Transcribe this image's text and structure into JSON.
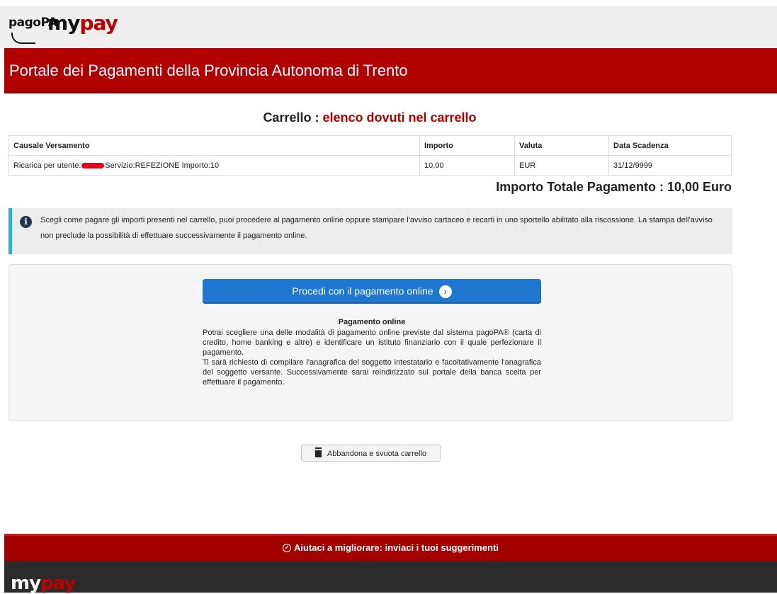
{
  "header": {
    "logo_pagopa": "pagoPA",
    "logo_my": "my",
    "logo_pay": "pay",
    "portal_title": "Portale dei Pagamenti della Provincia Autonoma di Trento"
  },
  "cart": {
    "title_prefix": "Carrello : ",
    "title_accent": "elenco dovuti nel carrello",
    "columns": [
      "Causale Versamento",
      "Importo",
      "Valuta",
      "Data Scadenza"
    ],
    "rows": [
      {
        "causale_prefix": "Ricarica per utente:",
        "causale_suffix": "Servizio:REFEZIONE Importo:10",
        "importo": "10,00",
        "valuta": "EUR",
        "scadenza": "31/12/9999"
      }
    ],
    "total_text": "Importo Totale Pagamento : 10,00 Euro"
  },
  "info": {
    "icon": "info-icon",
    "text": "Scegli come pagare gli importi presenti nel carrello, puoi procedere al pagamento online oppure stampare l'avviso cartaceo e recarti in uno sportello abilitato alla riscossione. La stampa dell'avviso non preclude la possibilità di effettuare successivamente il pagamento online."
  },
  "payment": {
    "button_label": "Procedi con il pagamento online",
    "heading": "Pagamento online",
    "description_1": "Potrai scegliere una delle modalità di pagamento online previste dal sistema pagoPA® (carta di credito, home banking e altre) e identificare un istituto finanziario con il quale perfezionare il pagamento.",
    "description_2": "Ti sarà richiesto di compilare l'anagrafica del soggetto intestatario e facoltativamente l'anagrafica del soggetto versante. Successivamente sarai reindirizzato sul portale della banca scelta per effettuare il pagamento."
  },
  "abandon_button": "Abbandona e svuota carrello",
  "footer": {
    "feedback_text": "Aiutaci a migliorare: inviaci i tuoi suggerimenti",
    "logo_my": "my",
    "logo_pay": "pay"
  },
  "colors": {
    "brand_red": "#b00000",
    "primary_blue": "#1f77cf",
    "info_accent": "#26b3c9"
  }
}
